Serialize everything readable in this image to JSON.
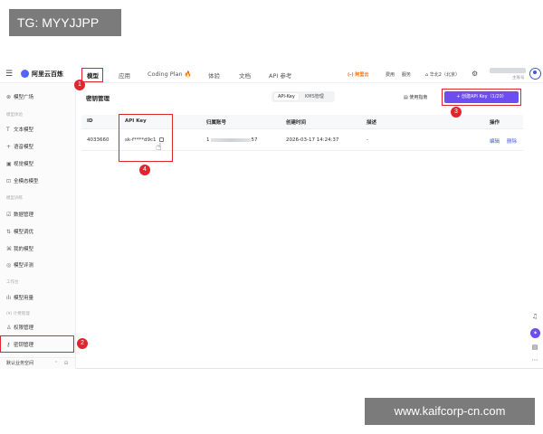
{
  "overlay": {
    "top_left_label": "TG: MYYJJPP",
    "bottom_right_label": "www.kaifcorp-cn.com"
  },
  "topbar": {
    "logo_text": "阿里云百炼",
    "nav": [
      "模型",
      "应用",
      "Coding Plan",
      "体验",
      "文档",
      "API 参考"
    ],
    "right_items": [
      "(-) 阿里云",
      "费用",
      "服务",
      "华北2（北京）"
    ],
    "user_sub": "主账号",
    "fire_icon": "fire-icon"
  },
  "sidebar": {
    "items": {
      "model_square": "模型广场",
      "group_experience": "模型体验",
      "text_model": "文本模型",
      "voice_model": "语音模型",
      "visual_model": "视觉模型",
      "omni_model": "全模态模型",
      "group_training": "模型训练",
      "data_management": "数据管理",
      "model_tuning": "模型调优",
      "my_models": "我的模型",
      "model_evaluation": "模型评测",
      "group_workspace": "工作台",
      "model_usage": "模型用量",
      "group_pending": "(¥) 计费管理",
      "permission_management": "权限管理",
      "key_management": "密钥管理"
    },
    "footer_workspace": "默认业务空间"
  },
  "main": {
    "title": "密钥管理",
    "segments": [
      "API-Key",
      "KMS管理"
    ],
    "guide_label": "使用指南",
    "create_button": "+ 创建API Key（1/20）",
    "table": {
      "headers": [
        "ID",
        "API Key",
        "归属账号",
        "创建时间",
        "描述",
        "操作"
      ],
      "row": {
        "id": "4033660",
        "api_key_prefix": "sk-f",
        "api_key_suffix": "****d9c1",
        "account_prefix": "1",
        "account_suffix": "57",
        "created": "2026-03-17 14:24:37",
        "description": "-",
        "action_edit": "编辑",
        "action_delete": "删除"
      }
    }
  },
  "annotations": [
    "1",
    "2",
    "3",
    "4"
  ],
  "colors": {
    "accent": "#6e4df0",
    "highlight": "#e0262d",
    "link": "#3f5ad8",
    "fire": "#ff6a00"
  }
}
